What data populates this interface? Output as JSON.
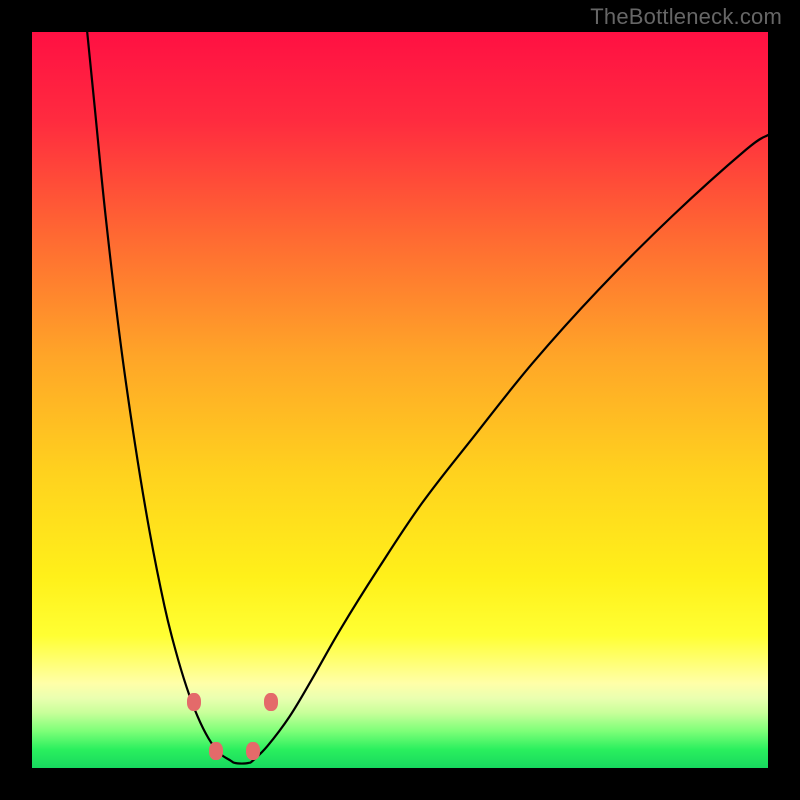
{
  "watermark": "TheBottleneck.com",
  "chart_data": {
    "type": "line",
    "title": "",
    "xlabel": "",
    "ylabel": "",
    "xlim": [
      0,
      100
    ],
    "ylim": [
      0,
      100
    ],
    "gradient_stops": [
      {
        "offset": 0.0,
        "color": "#ff1043"
      },
      {
        "offset": 0.12,
        "color": "#ff2b3f"
      },
      {
        "offset": 0.28,
        "color": "#ff6a32"
      },
      {
        "offset": 0.44,
        "color": "#ffa528"
      },
      {
        "offset": 0.6,
        "color": "#ffd21e"
      },
      {
        "offset": 0.74,
        "color": "#fff01a"
      },
      {
        "offset": 0.82,
        "color": "#ffff33"
      },
      {
        "offset": 0.885,
        "color": "#ffffa8"
      },
      {
        "offset": 0.905,
        "color": "#eaffb0"
      },
      {
        "offset": 0.925,
        "color": "#c8ff9a"
      },
      {
        "offset": 0.95,
        "color": "#7dff78"
      },
      {
        "offset": 0.975,
        "color": "#2aef5e"
      },
      {
        "offset": 1.0,
        "color": "#17d85e"
      }
    ],
    "series": [
      {
        "name": "left-branch",
        "x": [
          7.5,
          8.5,
          10,
          12,
          14,
          16,
          18,
          19.5,
          21,
          22.5,
          24,
          25.5,
          27
        ],
        "y": [
          100,
          90,
          75,
          58,
          44,
          32,
          22,
          16,
          11,
          7,
          4,
          2,
          1
        ]
      },
      {
        "name": "right-branch",
        "x": [
          30,
          32,
          35,
          38,
          42,
          47,
          53,
          60,
          68,
          77,
          87,
          97,
          100
        ],
        "y": [
          1,
          3,
          7,
          12,
          19,
          27,
          36,
          45,
          55,
          65,
          75,
          84,
          86
        ]
      }
    ],
    "valley_floor": {
      "x_start": 27,
      "x_end": 30,
      "y": 0.7
    },
    "markers": [
      {
        "name": "left-upper",
        "x": 22,
        "y": 9
      },
      {
        "name": "left-lower",
        "x": 25,
        "y": 2.3
      },
      {
        "name": "right-lower",
        "x": 30,
        "y": 2.3
      },
      {
        "name": "right-upper",
        "x": 32.5,
        "y": 9
      }
    ],
    "curve_color": "#000000",
    "curve_width": 2.2,
    "marker_color": "#e46a6a"
  }
}
